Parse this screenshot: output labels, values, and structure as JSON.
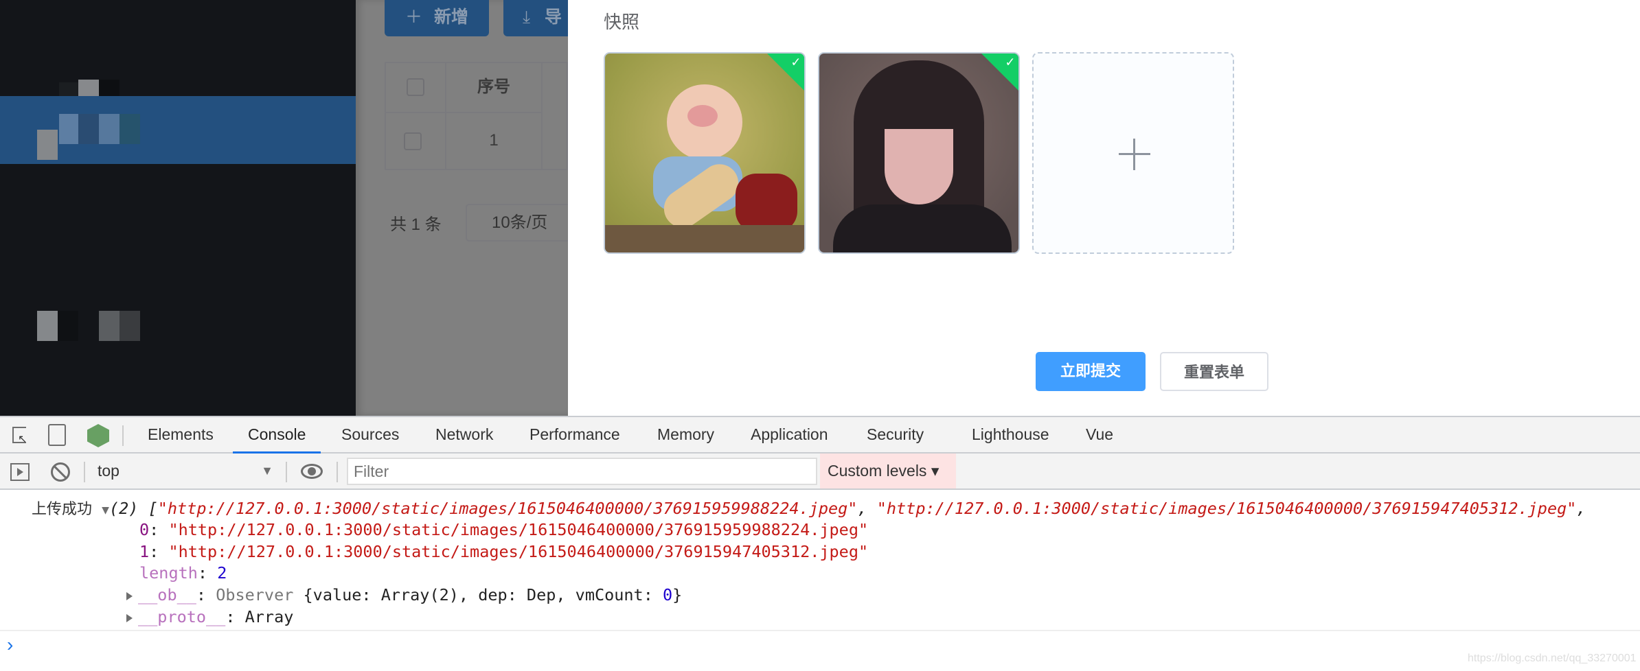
{
  "app": {
    "toolbar": {
      "add_label": "新增",
      "export_label": "导"
    },
    "table": {
      "headers": [
        "序号"
      ],
      "rows": [
        [
          "1"
        ]
      ]
    },
    "pagination": {
      "total_label": "共 1 条",
      "page_size": "10条/页"
    }
  },
  "drawer": {
    "field_label": "快照",
    "images": [
      {
        "name": "pig-playing-guitar",
        "status": "success"
      },
      {
        "name": "girl-portrait",
        "status": "success"
      }
    ],
    "submit_label": "立即提交",
    "reset_label": "重置表单",
    "colors": {
      "primary": "#409eff",
      "success": "#13ce66"
    }
  },
  "devtools": {
    "tabs": [
      "Elements",
      "Console",
      "Sources",
      "Network",
      "Performance",
      "Memory",
      "Application",
      "Security",
      "Lighthouse",
      "Vue"
    ],
    "active_tab": "Console",
    "context": "top",
    "filter_placeholder": "Filter",
    "levels_label": "Custom levels ▾",
    "console": {
      "message_label": "上传成功",
      "summary_prefix": "(2) [",
      "url0": "\"http://127.0.0.1:3000/static/images/1615046400000/376915959988224.jpeg\"",
      "url1": "\"http://127.0.0.1:3000/static/images/1615046400000/376915947405312.jpeg\"",
      "sep": ", ",
      "trail": ",",
      "idx0": "0",
      "idx1": "1",
      "length_key": "length",
      "length_value": "2",
      "ob_key": "__ob__",
      "ob_class": "Observer",
      "ob_body_a": " {value: Array(2), dep: Dep, vmCount: ",
      "ob_vmcount": "0",
      "ob_body_b": "}",
      "proto_key": "__proto__",
      "proto_value": "Array",
      "prompt": "›"
    },
    "watermark": "https://blog.csdn.net/qq_33270001"
  }
}
